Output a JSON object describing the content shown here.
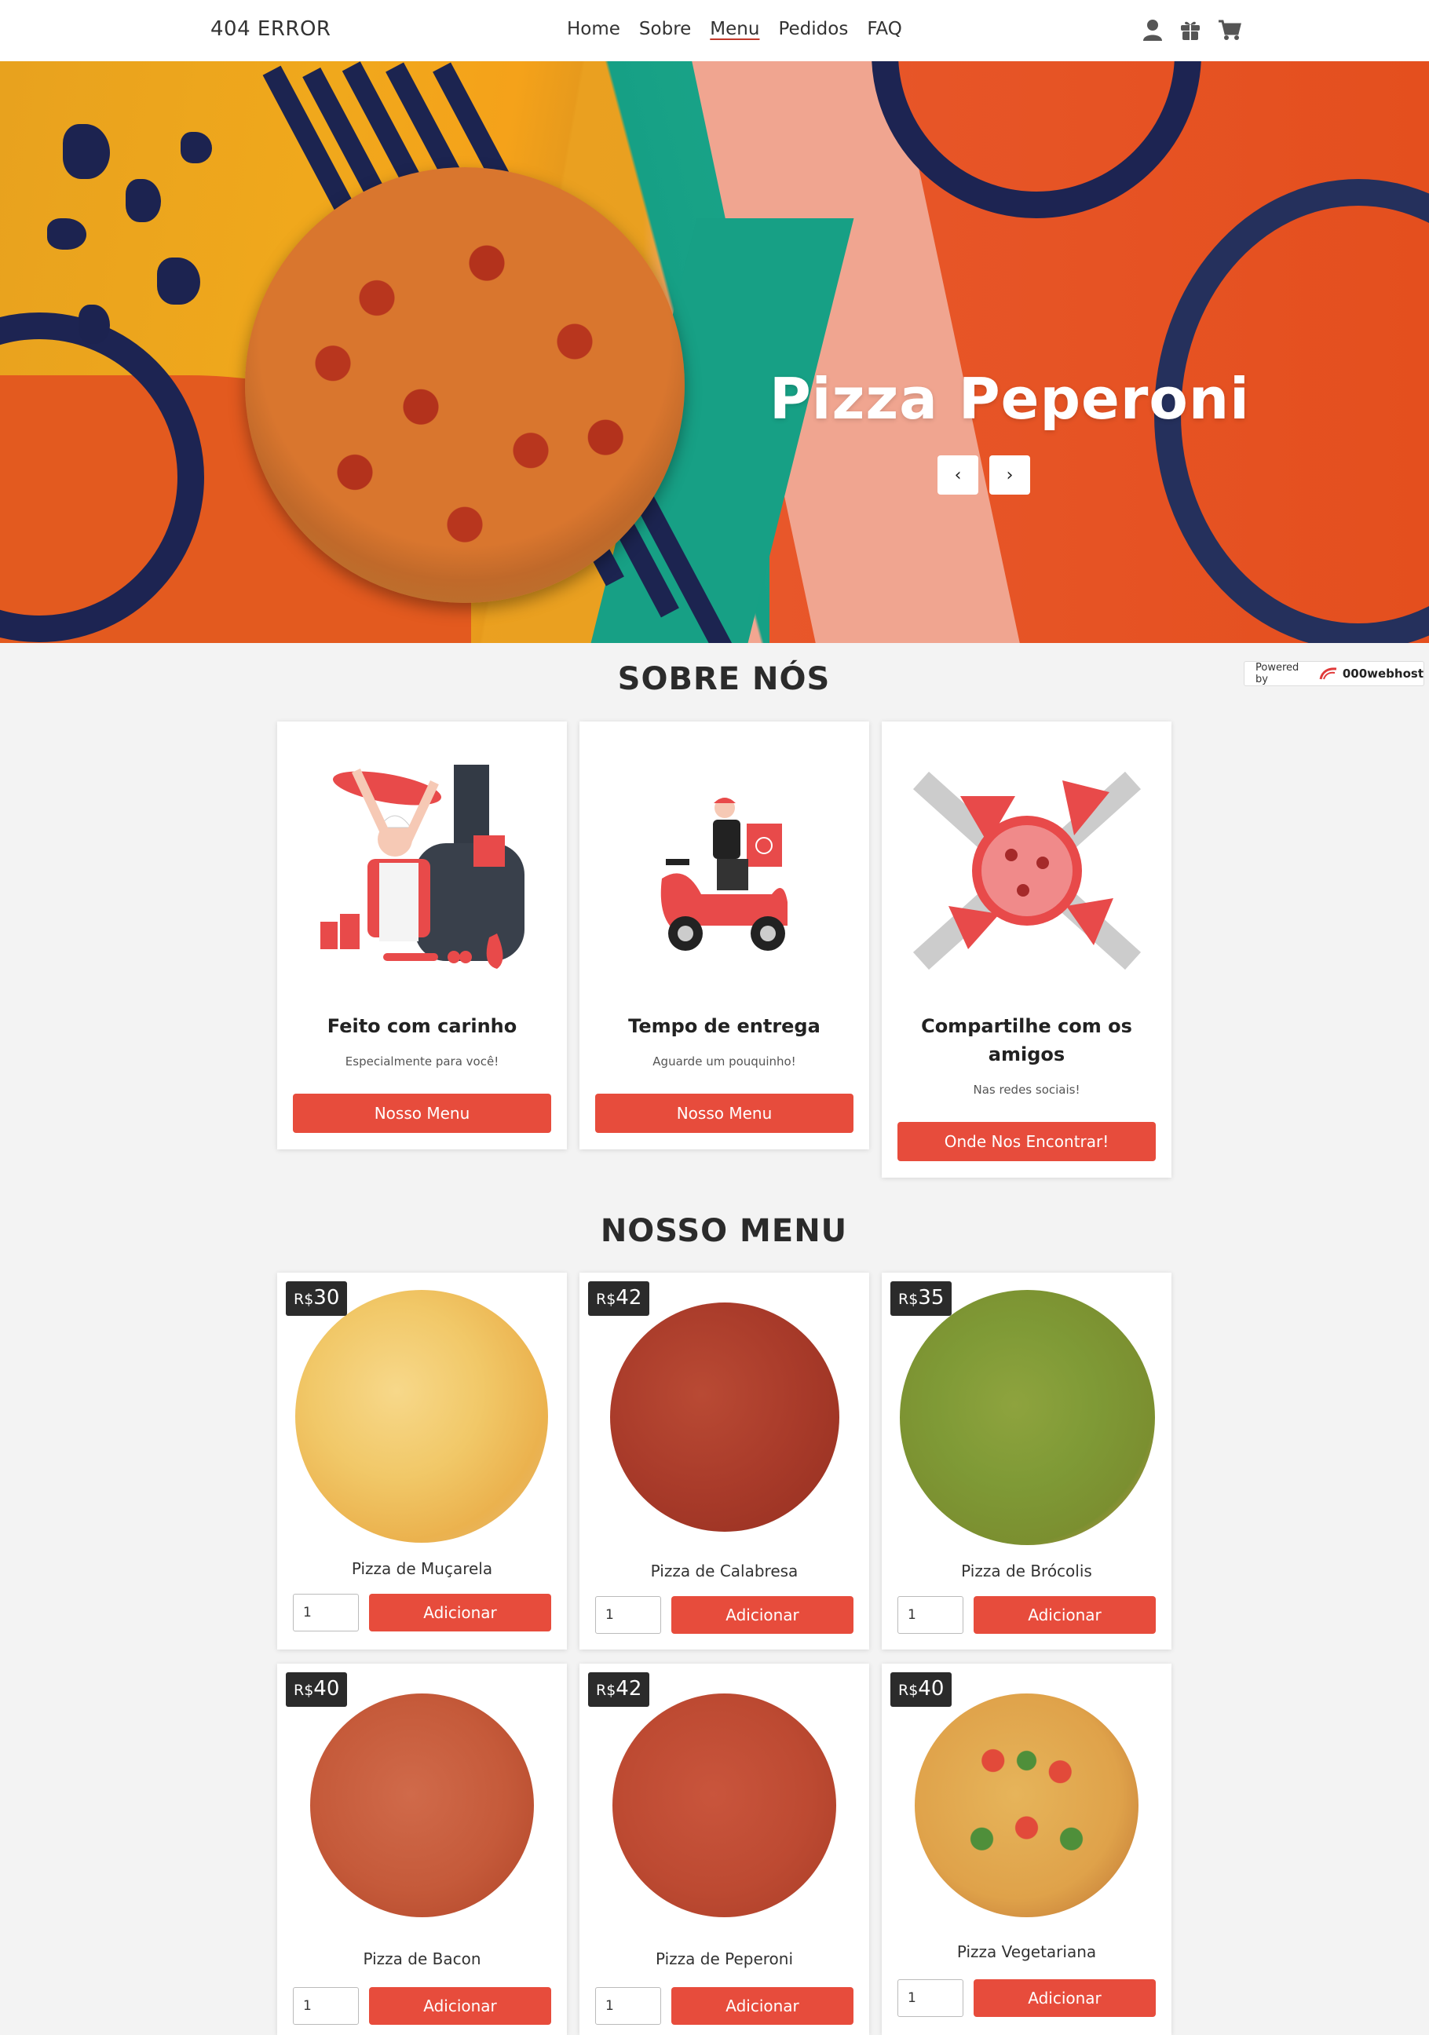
{
  "nav": {
    "brand": "404 ERROR",
    "links": [
      "Home",
      "Sobre",
      "Menu",
      "Pedidos",
      "FAQ"
    ],
    "active": "Menu",
    "icons": [
      "user-icon",
      "gift-icon",
      "cart-icon"
    ]
  },
  "hero": {
    "title": "Pizza Peperoni",
    "prev_icon": "chevron-left-icon",
    "next_icon": "chevron-right-icon"
  },
  "powered": {
    "label": "Powered by",
    "host": "000webhost"
  },
  "about": {
    "title": "SOBRE NÓS",
    "cards": [
      {
        "title": "Feito com carinho",
        "subtitle": "Especialmente para você!",
        "button": "Nosso Menu",
        "illustration": "chef-tossing-pizza"
      },
      {
        "title": "Tempo de entrega",
        "subtitle": "Aguarde um pouquinho!",
        "button": "Nosso Menu",
        "illustration": "delivery-scooter"
      },
      {
        "title": "Compartilhe com os amigos",
        "subtitle": "Nas redes sociais!",
        "button": "Onde Nos Encontrar!",
        "illustration": "friends-sharing-pizza"
      }
    ]
  },
  "menu": {
    "title": "NOSSO MENU",
    "currency": "R$",
    "add_label": "Adicionar",
    "items": [
      {
        "name": "Pizza de Muçarela",
        "price": "30",
        "qty": "1"
      },
      {
        "name": "Pizza de Calabresa",
        "price": "42",
        "qty": "1"
      },
      {
        "name": "Pizza de Brócolis",
        "price": "35",
        "qty": "1"
      },
      {
        "name": "Pizza de Bacon",
        "price": "40",
        "qty": "1"
      },
      {
        "name": "Pizza de Peperoni",
        "price": "42",
        "qty": "1"
      },
      {
        "name": "Pizza Vegetariana",
        "price": "40",
        "qty": "1"
      }
    ]
  },
  "colors": {
    "accent": "#e74c3c",
    "price_badge": "#2b2b2b",
    "background": "#f3f3f3"
  }
}
